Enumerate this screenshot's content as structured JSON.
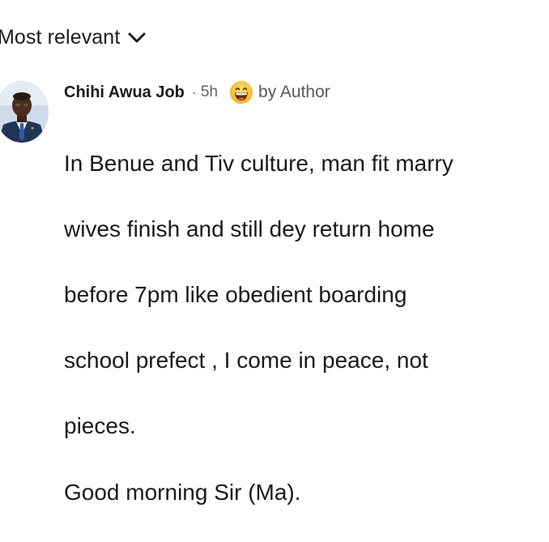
{
  "sort": {
    "label": "Most relevant",
    "icon": "chevron-down-icon"
  },
  "comment": {
    "author": "Chihi Awua Job",
    "separator": "·",
    "time": "5h",
    "reaction_icon": "grinning-face-emoji-icon",
    "badge": "by Author",
    "lines": [
      "In Benue and Tiv culture, man fit marry",
      "wives finish and still dey return home",
      "before 7pm like obedient boarding",
      "school prefect , I come in peace, not",
      "pieces.",
      "Good morning Sir (Ma)."
    ]
  }
}
